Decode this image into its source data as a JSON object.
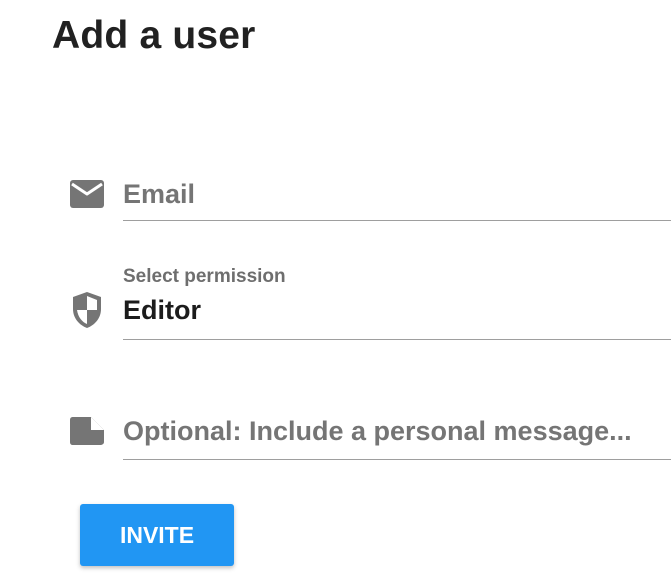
{
  "page": {
    "title": "Add a user"
  },
  "form": {
    "email": {
      "placeholder": "Email",
      "value": "",
      "icon": "email-icon"
    },
    "permission": {
      "label": "Select permission",
      "selected": "Editor",
      "icon": "shield-icon"
    },
    "message": {
      "placeholder": "Optional: Include a personal message...",
      "value": "",
      "icon": "note-icon"
    },
    "invite_label": "INVITE"
  },
  "colors": {
    "accent": "#2196f3",
    "icon": "#757575",
    "underline": "#9e9e9e"
  }
}
